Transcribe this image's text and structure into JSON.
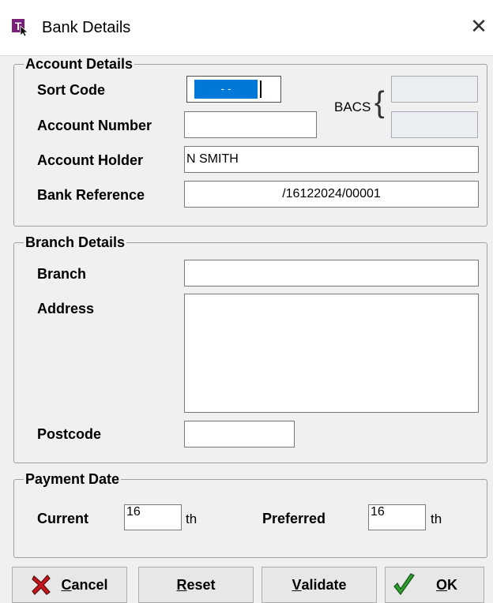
{
  "window": {
    "title": "Bank Details",
    "close_icon": "close-icon"
  },
  "account": {
    "legend": "Account Details",
    "sort_code_label": "Sort Code",
    "sort_code_value": "- -",
    "account_number_label": "Account Number",
    "account_number_value": "",
    "account_holder_label": "Account Holder",
    "account_holder_value": "N SMITH",
    "bank_reference_label": "Bank Reference",
    "bank_reference_value": "/16122024/00001",
    "bacs_label": "BACS",
    "bacs_value_1": "",
    "bacs_value_2": ""
  },
  "branch": {
    "legend": "Branch Details",
    "branch_label": "Branch",
    "branch_value": "",
    "address_label": "Address",
    "address_value": "",
    "postcode_label": "Postcode",
    "postcode_value": ""
  },
  "payment": {
    "legend": "Payment Date",
    "current_label": "Current",
    "current_value": "16",
    "current_suffix": "th",
    "preferred_label": "Preferred",
    "preferred_value": "16",
    "preferred_suffix": "th"
  },
  "buttons": {
    "cancel_first": "C",
    "cancel_rest": "ancel",
    "reset_first": "R",
    "reset_rest": "eset",
    "validate_first": "V",
    "validate_rest": "alidate",
    "ok_first": "O",
    "ok_rest": "K"
  },
  "colors": {
    "selection": "#0078d7",
    "cancel_icon": "#c4161c",
    "ok_icon": "#2e9e2e",
    "app_icon": "#7a1f7a"
  }
}
